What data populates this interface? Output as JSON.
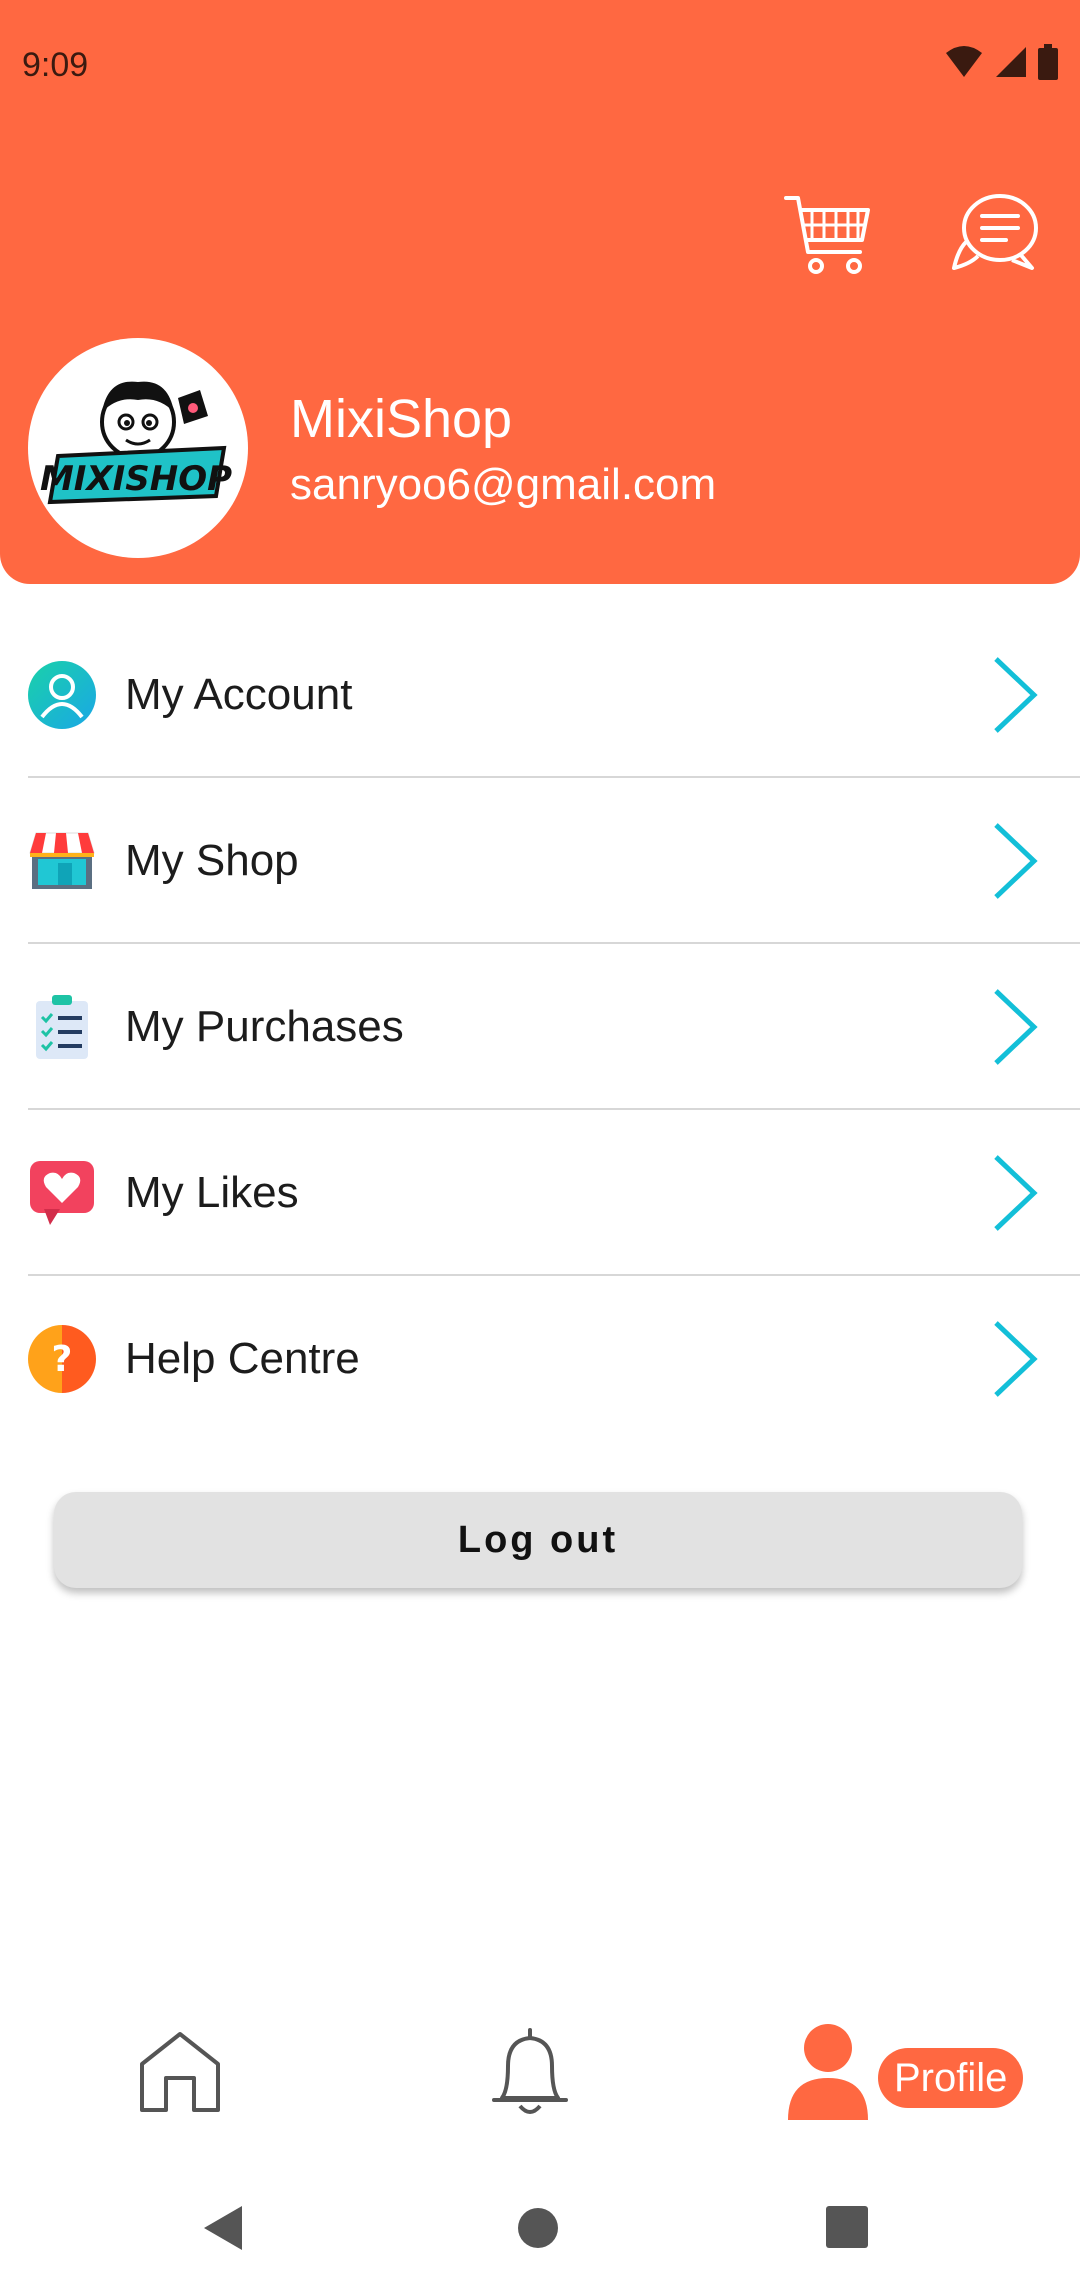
{
  "status_bar": {
    "time": "9:09"
  },
  "profile": {
    "name": "MixiShop",
    "email": "sanryoo6@gmail.com",
    "avatar_text": "MIXISHOP"
  },
  "menu": [
    {
      "label": "My Account",
      "icon": "user-icon"
    },
    {
      "label": "My Shop",
      "icon": "shop-icon"
    },
    {
      "label": "My Purchases",
      "icon": "checklist-icon"
    },
    {
      "label": "My Likes",
      "icon": "heart-icon"
    },
    {
      "label": "Help Centre",
      "icon": "help-icon"
    }
  ],
  "logout_label": "Log out",
  "bottom_nav": {
    "profile_label": "Profile"
  },
  "colors": {
    "accent": "#FF6841",
    "chevron": "#13BFD8"
  }
}
